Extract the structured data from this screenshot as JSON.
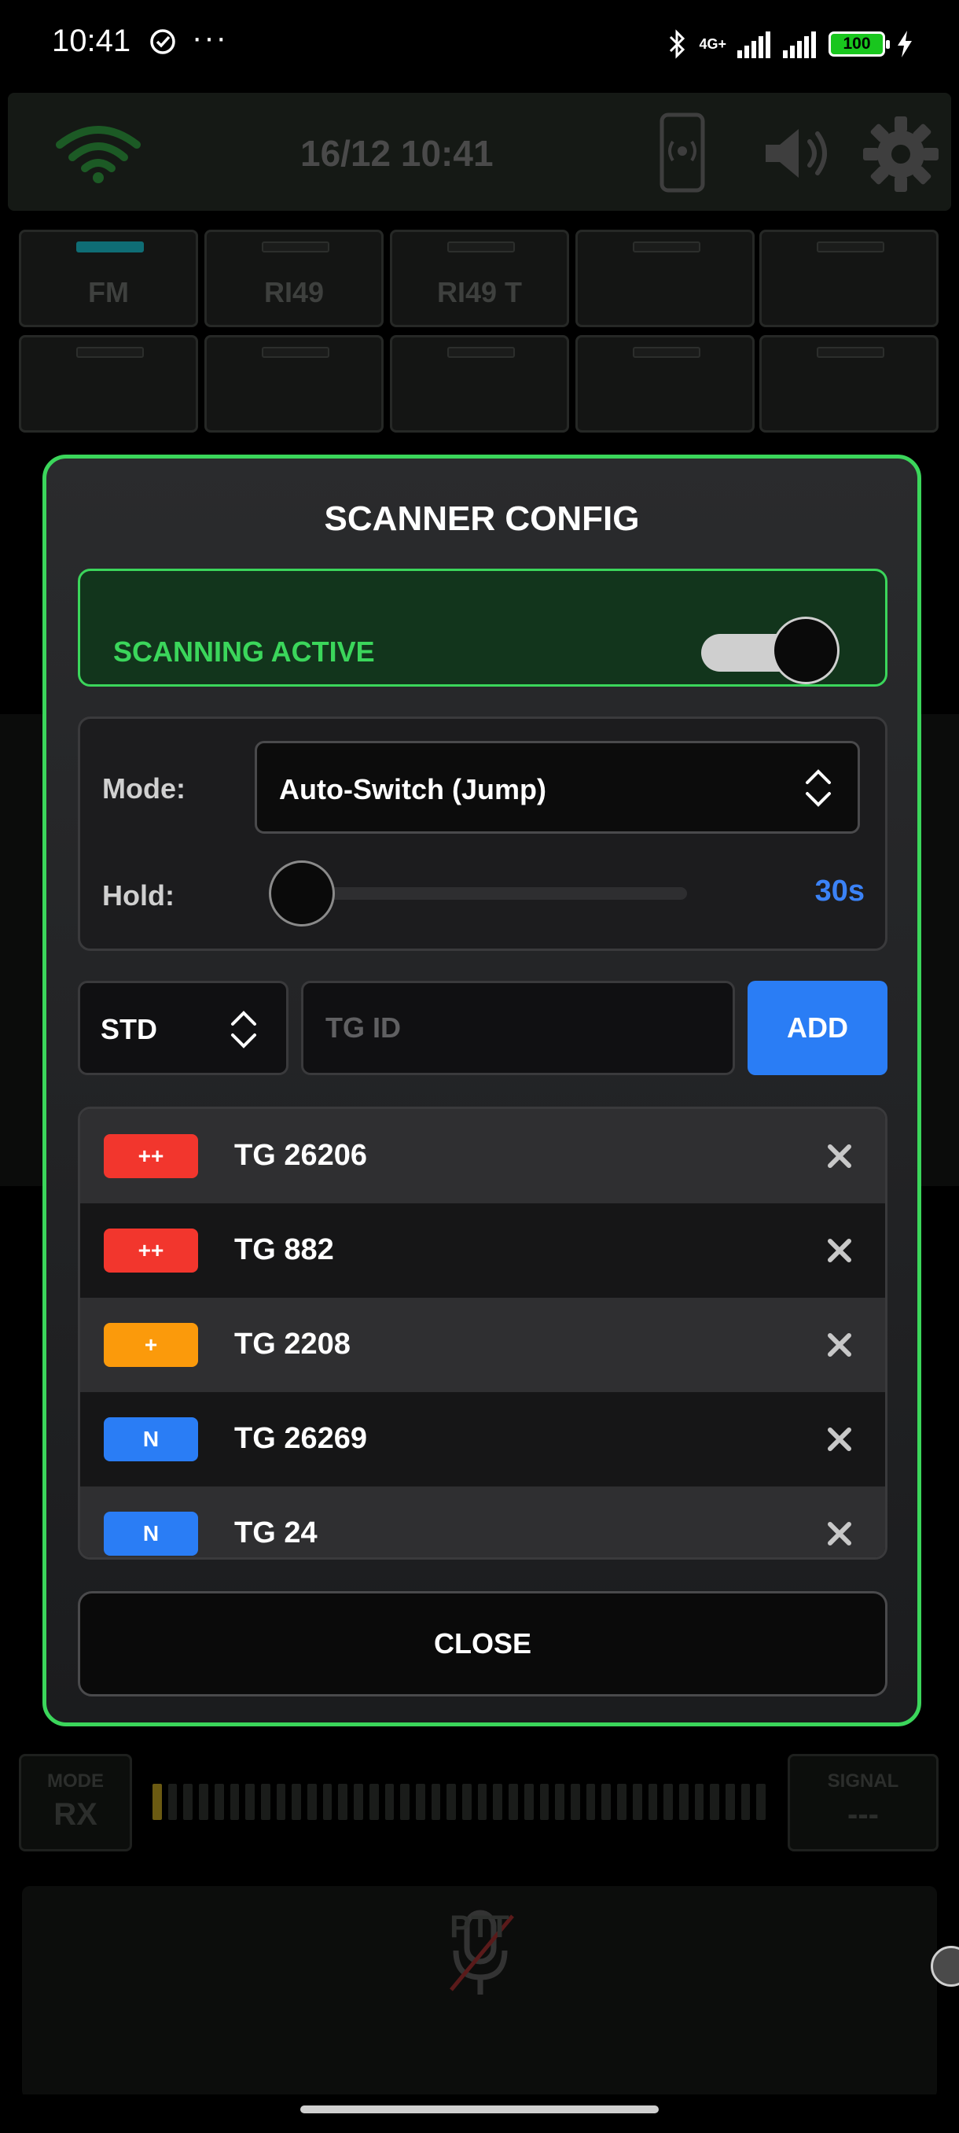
{
  "status_bar": {
    "time": "10:41",
    "dots": "···",
    "network": "4G+",
    "battery": "100"
  },
  "app": {
    "header_datetime": "16/12  10:41",
    "tabs": [
      "FM",
      "RI49",
      "RI49 T",
      "",
      "",
      "",
      "",
      "",
      "",
      ""
    ],
    "mode_box": {
      "label": "MODE",
      "value": "RX"
    },
    "signal_box": {
      "label": "SIGNAL",
      "value": "---"
    },
    "ptt_label": "PTT"
  },
  "modal": {
    "title": "SCANNER CONFIG",
    "scanning": {
      "label": "SCANNING ACTIVE",
      "enabled": true
    },
    "mode": {
      "label": "Mode:",
      "value": "Auto-Switch (Jump)"
    },
    "hold": {
      "label": "Hold:",
      "value": "30s"
    },
    "priority_select": {
      "value": "STD"
    },
    "tg_input": {
      "placeholder": "TG ID",
      "value": ""
    },
    "add_label": "ADD",
    "talkgroups": [
      {
        "badge": "++",
        "badge_color": "#f2362d",
        "name": "TG 26206"
      },
      {
        "badge": "++",
        "badge_color": "#f2362d",
        "name": "TG 882"
      },
      {
        "badge": "+",
        "badge_color": "#fb9a0b",
        "name": "TG 2208"
      },
      {
        "badge": "N",
        "badge_color": "#2a7df5",
        "name": "TG 26269"
      },
      {
        "badge": "N",
        "badge_color": "#2a7df5",
        "name": "TG 24"
      }
    ],
    "close_label": "CLOSE"
  },
  "colors": {
    "accent_green": "#3bd65b",
    "accent_blue": "#2a7df5",
    "hold_value": "#3b82f6"
  },
  "icons": [
    "check-circle-icon",
    "bluetooth-icon",
    "signal-bars-icon",
    "charging-icon",
    "wifi-icon",
    "phone-broadcast-icon",
    "speaker-icon",
    "gear-icon",
    "chevron-updown-icon",
    "close-x-icon",
    "microphone-muted-icon"
  ]
}
